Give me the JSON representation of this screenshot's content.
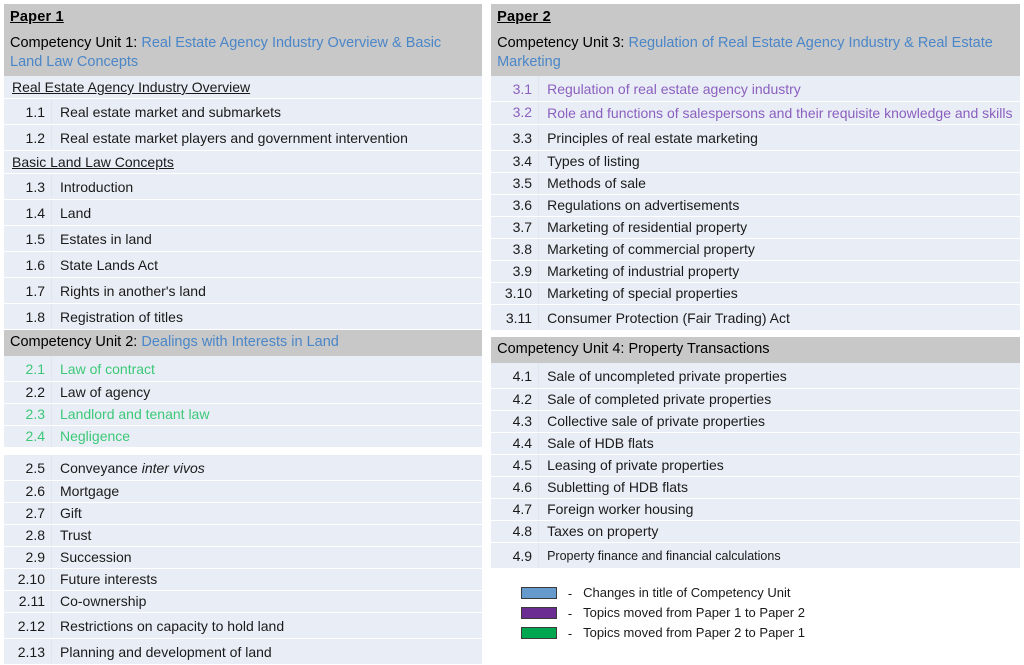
{
  "colors": {
    "band_gray": "#c8c8c8",
    "row_blue_gray": "#e9eef6",
    "heading_blue": "#4a86c8",
    "moved_green_text": "#3cc878",
    "moved_purple_text": "#8b5fbf",
    "legend_blue_swatch": "#6699cc",
    "legend_purple_swatch": "#6b2d91",
    "legend_green_swatch": "#00a650"
  },
  "paper1": {
    "title": "Paper 1",
    "unit1": {
      "prefix": "Competency Unit 1:",
      "name": "Real Estate Agency Industry Overview & Basic Land Law Concepts",
      "sections": [
        {
          "heading": "Real Estate Agency Industry Overview",
          "items": [
            {
              "num": "1.1",
              "text": "Real estate market and submarkets",
              "color": "black"
            },
            {
              "num": "1.2",
              "text": "Real estate market players and government intervention",
              "color": "black"
            }
          ]
        },
        {
          "heading": "Basic Land Law Concepts",
          "items": [
            {
              "num": "1.3",
              "text": "Introduction",
              "color": "black"
            },
            {
              "num": "1.4",
              "text": "Land",
              "color": "black"
            },
            {
              "num": "1.5",
              "text": "Estates in land",
              "color": "black"
            },
            {
              "num": "1.6",
              "text": "State Lands Act",
              "color": "black"
            },
            {
              "num": "1.7",
              "text": "Rights in another's land",
              "color": "black"
            },
            {
              "num": "1.8",
              "text": "Registration of titles",
              "color": "black"
            }
          ]
        }
      ]
    },
    "unit2": {
      "prefix": "Competency Unit 2:",
      "name": "Dealings with Interests in Land",
      "items": [
        {
          "num": "2.1",
          "text": "Law of contract",
          "color": "green"
        },
        {
          "num": "2.2",
          "text": "Law of agency",
          "color": "black"
        },
        {
          "num": "2.3",
          "text": "Landlord and tenant law",
          "color": "green"
        },
        {
          "num": "2.4",
          "text": "Negligence",
          "color": "green"
        },
        {
          "num": "2.5",
          "text": "Conveyance inter vivos",
          "color": "black",
          "italic_tail": "inter vivos",
          "head": "Conveyance "
        },
        {
          "num": "2.6",
          "text": "Mortgage",
          "color": "black"
        },
        {
          "num": "2.7",
          "text": "Gift",
          "color": "black"
        },
        {
          "num": "2.8",
          "text": "Trust",
          "color": "black"
        },
        {
          "num": "2.9",
          "text": "Succession",
          "color": "black"
        },
        {
          "num": "2.10",
          "text": "Future interests",
          "color": "black"
        },
        {
          "num": "2.11",
          "text": "Co-ownership",
          "color": "black"
        },
        {
          "num": "2.12",
          "text": "Restrictions on capacity to hold land",
          "color": "black"
        },
        {
          "num": "2.13",
          "text": "Planning and development of land",
          "color": "black"
        }
      ]
    }
  },
  "paper2": {
    "title": "Paper 2",
    "unit3": {
      "prefix": "Competency Unit 3:",
      "name": "Regulation of Real Estate Agency Industry & Real Estate Marketing",
      "items": [
        {
          "num": "3.1",
          "text": "Regulation of real estate agency industry",
          "color": "purple"
        },
        {
          "num": "3.2",
          "text": "Role and functions of salespersons and their requisite knowledge and skills",
          "color": "purple"
        },
        {
          "num": "3.3",
          "text": "Principles of real estate marketing",
          "color": "black"
        },
        {
          "num": "3.4",
          "text": "Types of listing",
          "color": "black"
        },
        {
          "num": "3.5",
          "text": "Methods of sale",
          "color": "black"
        },
        {
          "num": "3.6",
          "text": "Regulations on advertisements",
          "color": "black"
        },
        {
          "num": "3.7",
          "text": "Marketing of residential property",
          "color": "black"
        },
        {
          "num": "3.8",
          "text": "Marketing of commercial property",
          "color": "black"
        },
        {
          "num": "3.9",
          "text": "Marketing of industrial property",
          "color": "black"
        },
        {
          "num": "3.10",
          "text": "Marketing of special properties",
          "color": "black"
        },
        {
          "num": "3.11",
          "text": "Consumer Protection (Fair Trading) Act",
          "color": "black"
        }
      ]
    },
    "unit4": {
      "prefix": "Competency Unit 4:",
      "name": "Property Transactions",
      "items": [
        {
          "num": "4.1",
          "text": "Sale of uncompleted private properties",
          "color": "black"
        },
        {
          "num": "4.2",
          "text": "Sale of completed private properties",
          "color": "black"
        },
        {
          "num": "4.3",
          "text": "Collective sale of private properties",
          "color": "black"
        },
        {
          "num": "4.4",
          "text": "Sale of HDB flats",
          "color": "black"
        },
        {
          "num": "4.5",
          "text": "Leasing of private properties",
          "color": "black"
        },
        {
          "num": "4.6",
          "text": "Subletting of HDB flats",
          "color": "black"
        },
        {
          "num": "4.7",
          "text": "Foreign worker housing",
          "color": "black"
        },
        {
          "num": "4.8",
          "text": "Taxes on property",
          "color": "black"
        },
        {
          "num": "4.9",
          "text": "Property finance and financial calculations",
          "color": "black"
        }
      ]
    },
    "legend": {
      "dash": "-",
      "entries": [
        {
          "swatch": "#6699cc",
          "label": "Changes in title of Competency Unit"
        },
        {
          "swatch": "#6b2d91",
          "label": "Topics moved from Paper 1 to Paper 2"
        },
        {
          "swatch": "#00a650",
          "label": "Topics moved from Paper 2 to Paper 1"
        }
      ]
    }
  }
}
